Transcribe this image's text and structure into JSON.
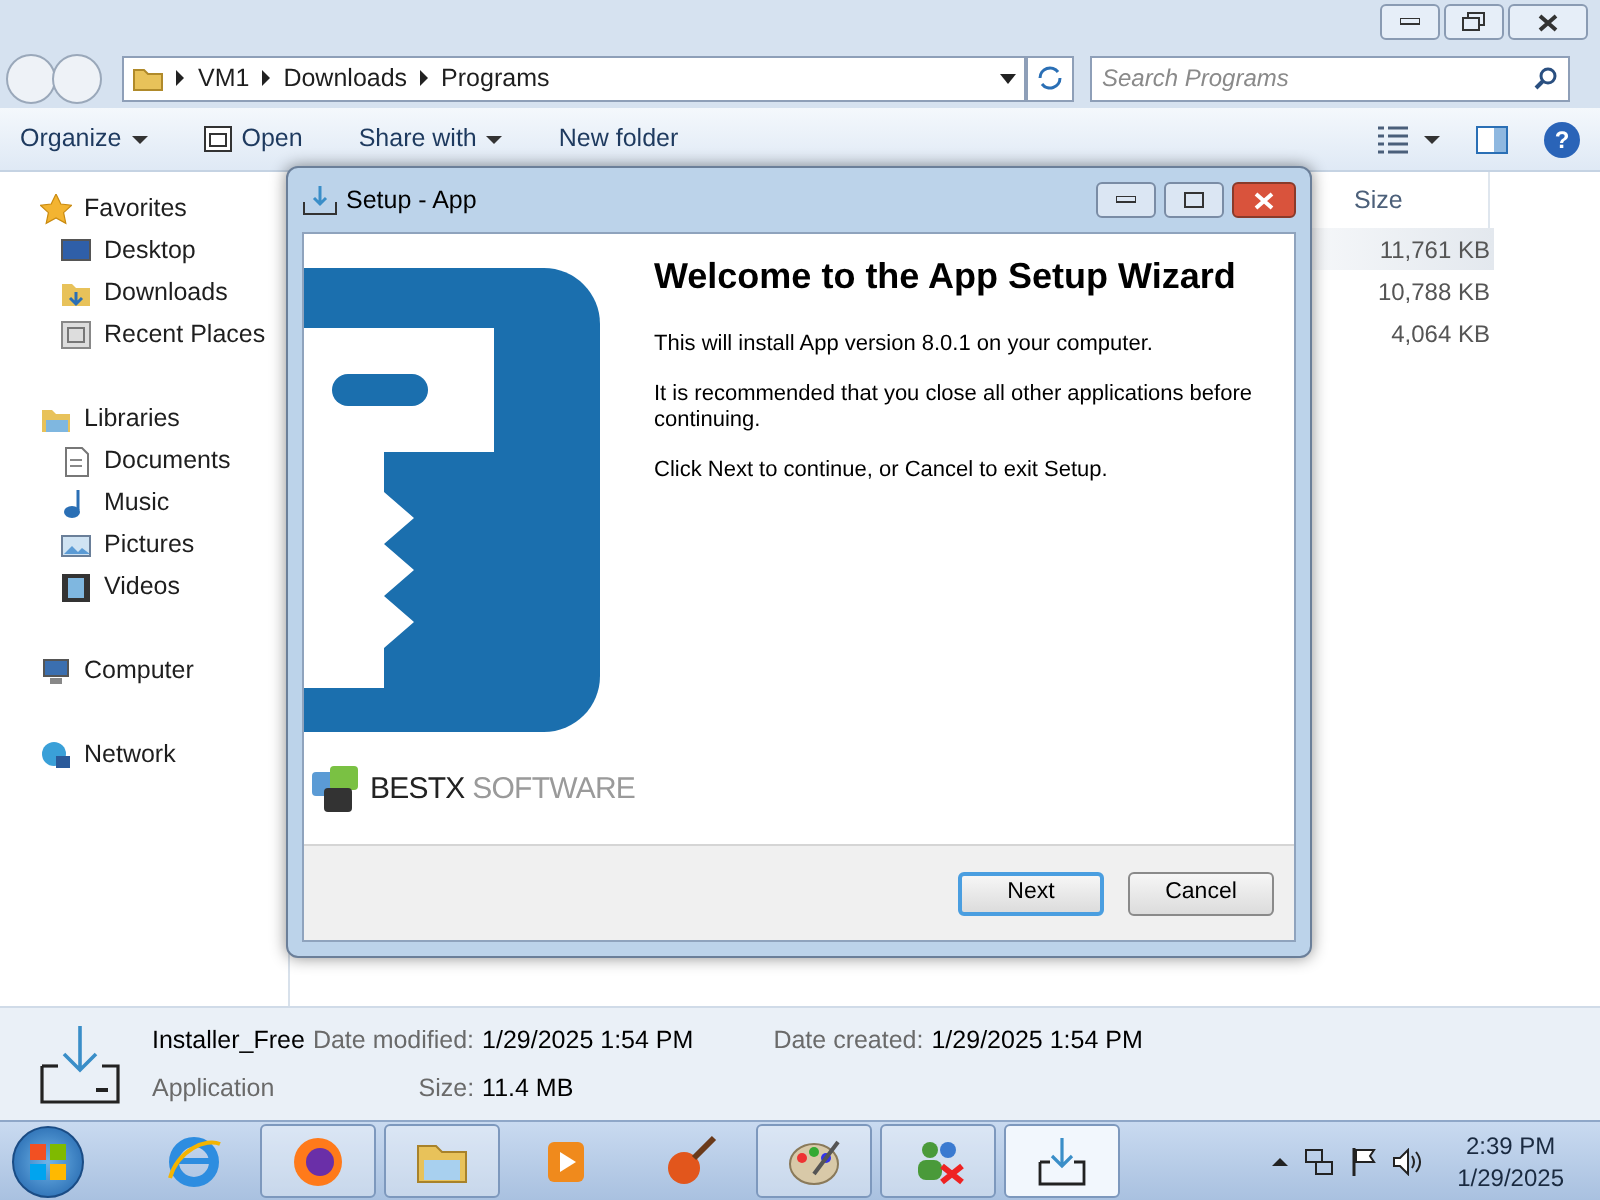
{
  "explorer": {
    "address_path": [
      "VM1",
      "Downloads",
      "Programs"
    ],
    "search": {
      "placeholder": "Search Programs"
    },
    "toolbar": [
      {
        "label": "Organize",
        "dropdown": true
      },
      {
        "label": "Open",
        "dropdown": false
      },
      {
        "label": "Share with",
        "dropdown": true
      },
      {
        "label": "New folder",
        "dropdown": false
      }
    ],
    "nav": [
      {
        "label": "Favorites",
        "children": [
          {
            "label": "Desktop"
          },
          {
            "label": "Downloads"
          },
          {
            "label": "Recent Places"
          }
        ]
      },
      {
        "label": "Libraries",
        "children": [
          {
            "label": "Documents"
          },
          {
            "label": "Music"
          },
          {
            "label": "Pictures"
          },
          {
            "label": "Videos"
          }
        ]
      },
      {
        "label": "Computer"
      },
      {
        "label": "Network"
      }
    ],
    "help": "?",
    "columns": [
      "Size"
    ],
    "rows": [
      {
        "size": "11,761 KB",
        "selected": true
      },
      {
        "size": "10,788 KB",
        "selected": false
      },
      {
        "size": "4,064 KB",
        "selected": false
      }
    ],
    "details": {
      "name": "Installer_Free",
      "type": "Application",
      "fields": [
        {
          "label": "Date modified:",
          "value": "1/29/2025 1:54 PM"
        },
        {
          "label": "Date created:",
          "value": "1/29/2025 1:54 PM"
        },
        {
          "label": "Size:",
          "value": "11.4 MB"
        }
      ]
    }
  },
  "dialog": {
    "title": "Setup - App",
    "brand": [
      "BESTX",
      "SOFTWARE"
    ],
    "heading": "Welcome to the App Setup Wizard",
    "paragraphs": [
      "This will install App version 8.0.1 on your computer.",
      "It is recommended that you close all other applications before continuing.",
      "Click Next to continue, or Cancel to exit Setup."
    ],
    "buttons": [
      {
        "label": "Next",
        "default": true
      },
      {
        "label": "Cancel",
        "default": false
      }
    ]
  },
  "taskbar": {
    "apps": [
      {
        "kind": "ie",
        "running": false,
        "selected": false
      },
      {
        "kind": "firefox",
        "running": true,
        "selected": false
      },
      {
        "kind": "folder",
        "running": true,
        "selected": false
      },
      {
        "kind": "media",
        "running": false,
        "selected": false
      },
      {
        "kind": "brush",
        "running": false,
        "selected": false
      },
      {
        "kind": "palette",
        "running": true,
        "selected": false
      },
      {
        "kind": "people",
        "running": true,
        "selected": false
      },
      {
        "kind": "installer",
        "running": true,
        "selected": true
      }
    ],
    "time": "2:39 PM",
    "date": "1/29/2025"
  }
}
